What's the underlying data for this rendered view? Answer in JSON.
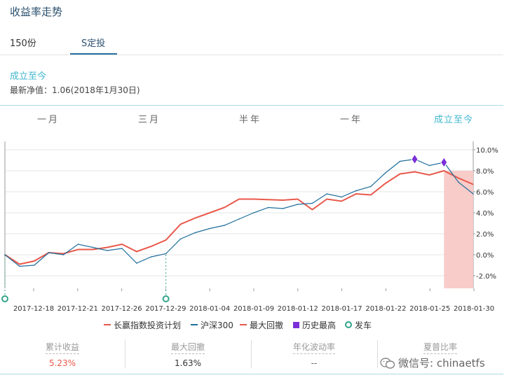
{
  "header": {
    "title": "收益率走势"
  },
  "tabs": [
    {
      "label": "150份"
    },
    {
      "label": "S定投"
    }
  ],
  "period": {
    "title": "成立至今",
    "nav_label": "最新净值：1.06(2018年1月30日)"
  },
  "ranges": [
    {
      "label": "一月"
    },
    {
      "label": "三月"
    },
    {
      "label": "半年"
    },
    {
      "label": "一年"
    },
    {
      "label": "成立至今"
    }
  ],
  "legend": [
    {
      "label": "长赢指数投资计划",
      "color": "#e8584b"
    },
    {
      "label": "沪深300",
      "color": "#1f6e9c"
    },
    {
      "label": "最大回撤",
      "color": "#e8584b"
    },
    {
      "label": "历史最高",
      "color": "#7b2fd8"
    },
    {
      "label": "发车",
      "color": "#33a48d"
    }
  ],
  "stats": [
    {
      "label": "累计收益",
      "value": "5.23%",
      "color": "#e8584b"
    },
    {
      "label": "最大回撤",
      "value": "1.63%",
      "color": "#333333"
    },
    {
      "label": "年化波动率",
      "value": "--",
      "color": "#333333"
    },
    {
      "label": "夏普比率",
      "value": "",
      "color": "#333333"
    }
  ],
  "watermark": {
    "text": "微信号: chinaetfs"
  },
  "chart_data": {
    "type": "line",
    "x_tick_labels": [
      "2017-12-18",
      "2017-12-21",
      "2017-12-26",
      "2017-12-29",
      "2018-01-04",
      "2018-01-09",
      "2018-01-12",
      "2018-01-17",
      "2018-01-22",
      "2018-01-25",
      "2018-01-30"
    ],
    "y_tick_labels": [
      "10.0%",
      "8.0%",
      "6.0%",
      "4.0%",
      "2.0%",
      "0.0%",
      "-2.0%"
    ],
    "ylim": [
      -3.2,
      10.8
    ],
    "y_ticks": [
      10,
      8,
      6,
      4,
      2,
      0,
      -2
    ],
    "n_points": 33,
    "series": [
      {
        "name": "长赢指数投资计划",
        "color": "#e8584b",
        "values": [
          0.0,
          -0.9,
          -0.6,
          0.2,
          0.1,
          0.5,
          0.5,
          0.7,
          1.0,
          0.3,
          0.8,
          1.4,
          2.9,
          3.5,
          4.0,
          4.5,
          5.3,
          5.3,
          5.25,
          5.2,
          5.3,
          4.3,
          5.3,
          5.1,
          5.8,
          5.7,
          6.8,
          7.7,
          7.9,
          7.6,
          8.0,
          7.3,
          6.7
        ]
      },
      {
        "name": "沪深300",
        "color": "#1f6e9c",
        "values": [
          0.0,
          -1.1,
          -1.0,
          0.2,
          0.0,
          1.0,
          0.7,
          0.4,
          0.6,
          -0.8,
          -0.2,
          0.1,
          1.5,
          2.1,
          2.5,
          2.8,
          3.4,
          4.0,
          4.5,
          4.4,
          4.8,
          4.9,
          5.8,
          5.5,
          6.1,
          6.5,
          7.8,
          8.9,
          9.1,
          8.5,
          8.8,
          6.9,
          5.8
        ]
      }
    ],
    "markers": {
      "historical_high_indices": [
        28,
        30
      ],
      "launch_indices": [
        0,
        11
      ],
      "drawdown_start_index": 30
    }
  }
}
